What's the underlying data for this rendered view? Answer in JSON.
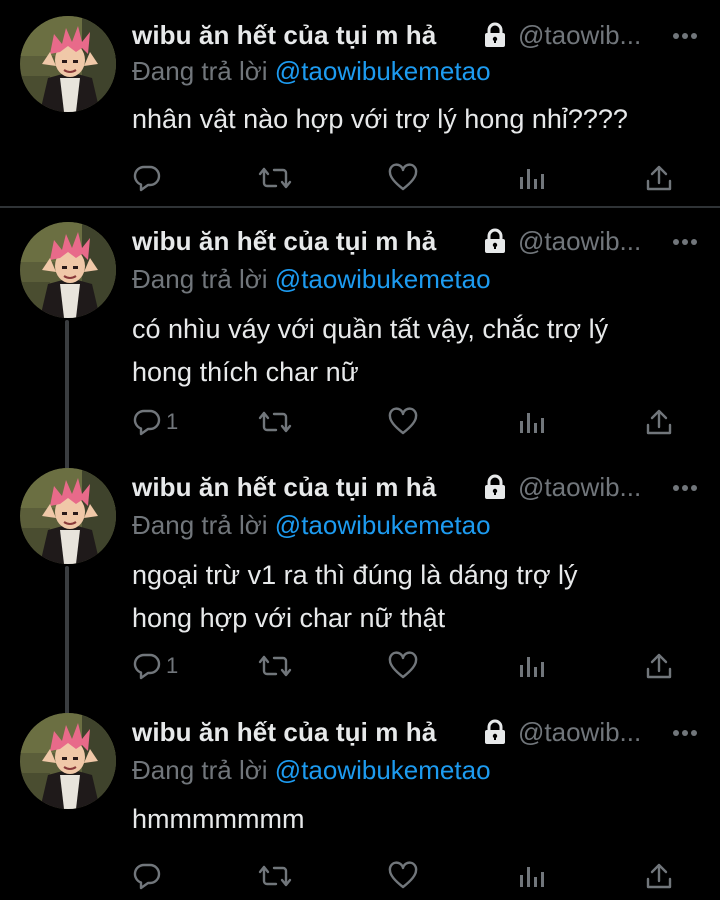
{
  "colors": {
    "background": "#000000",
    "text": "#e7e9ea",
    "muted": "#71767b",
    "link": "#1d9bf0",
    "divider": "#2f3336"
  },
  "tweets": [
    {
      "display_name": "wibu ăn hết của tụi m hả",
      "handle": "@taowib...",
      "reply_prefix": "Đang trả lời",
      "reply_to": "@taowibukemetao",
      "text_lines": [
        "nhân vật nào hợp với trợ lý hong nhỉ????"
      ],
      "reply_count": "",
      "icons": [
        "avatar",
        "lock-icon",
        "more-icon",
        "reply-icon",
        "retweet-icon",
        "like-icon",
        "analytics-icon",
        "share-icon"
      ]
    },
    {
      "display_name": "wibu ăn hết của tụi m hả",
      "handle": "@taowib...",
      "reply_prefix": "Đang trả lời",
      "reply_to": "@taowibukemetao",
      "text_lines": [
        "có nhìu váy với quần tất vậy, chắc trợ lý",
        "hong thích char nữ"
      ],
      "reply_count": "1"
    },
    {
      "display_name": "wibu ăn hết của tụi m hả",
      "handle": "@taowib...",
      "reply_prefix": "Đang trả lời",
      "reply_to": "@taowibukemetao",
      "text_lines": [
        "ngoại trừ v1 ra thì đúng là dáng trợ lý",
        "hong hợp với char nữ thật"
      ],
      "reply_count": "1"
    },
    {
      "display_name": "wibu ăn hết của tụi m hả",
      "handle": "@taowib...",
      "reply_prefix": "Đang trả lời",
      "reply_to": "@taowibukemetao",
      "text_lines": [
        "hmmmmmmm"
      ],
      "reply_count": ""
    }
  ]
}
